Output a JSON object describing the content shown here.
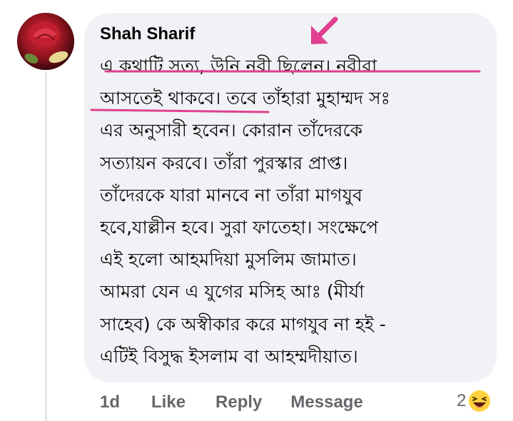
{
  "comment": {
    "author": "Shah Sharif",
    "lines": [
      "এ কথাটি সত্য, উনি নবী  ছিলেন। নবীরা",
      "আসতেই থাকবে।  তবে তাঁহারা মুহাম্মদ সঃ",
      "এর অনুসারী হবেন। কোরান তাঁদেরকে",
      "সত্যায়ন করবে। তাঁরা পুরস্কার প্রাপ্ত।",
      "তাঁদেরকে যারা মানবে না তাঁরা মাগযুব",
      "হবে,যাল্লীন হবে। সুরা ফাতেহা।  সংক্ষেপে",
      "এই হলো আহমদিয়া মুসলিম  জামাত।",
      "আমরা যেন  এ যুগের মসিহ আঃ (মীর্যা",
      "সাহেব) কে অস্বীকার করে মাগযুব না হই -",
      "এটিই  বিসুদ্ধ ইসলাম বা আহম্মদীয়াত।"
    ]
  },
  "actions": {
    "time": "1d",
    "like": "Like",
    "reply": "Reply",
    "message": "Message"
  },
  "reactions": {
    "count": "2",
    "icon": "laughing-emoji-icon"
  },
  "annotation": {
    "color": "#e0408f",
    "arrow_icon": "pink-arrow-icon"
  }
}
